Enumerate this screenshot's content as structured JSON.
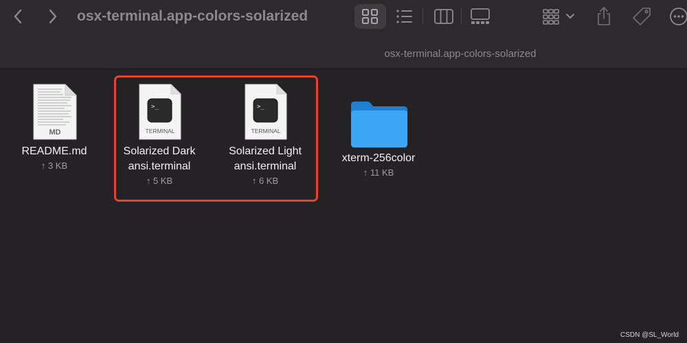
{
  "toolbar": {
    "title": "osx-terminal.app-colors-solarized",
    "back_icon": "chevron-left-icon",
    "forward_icon": "chevron-right-icon",
    "view_modes": [
      "grid-view-icon",
      "list-view-icon",
      "column-view-icon",
      "gallery-view-icon"
    ],
    "selected_view": "grid-view-icon",
    "group_icon": "group-by-icon",
    "share_icon": "share-icon",
    "tag_icon": "tag-icon",
    "more_icon": "more-icon"
  },
  "path_bar": {
    "title": "osx-terminal.app-colors-solarized"
  },
  "files": [
    {
      "name": "README.md",
      "size": "↑ 3 KB",
      "icon": "markdown-document-icon",
      "icon_label": "MD"
    },
    {
      "name": "Solarized Dark\nansi.terminal",
      "size": "↑ 5 KB",
      "icon": "terminal-document-icon",
      "icon_label": "TERMINAL"
    },
    {
      "name": "Solarized Light\nansi.terminal",
      "size": "↑ 6 KB",
      "icon": "terminal-document-icon",
      "icon_label": "TERMINAL"
    },
    {
      "name": "xterm-256color",
      "size": "↑ 11 KB",
      "icon": "folder-icon"
    }
  ],
  "highlight_color": "#e8442b",
  "accent_folder_color": "#3aa6f4",
  "watermark": "CSDN @SL_World"
}
